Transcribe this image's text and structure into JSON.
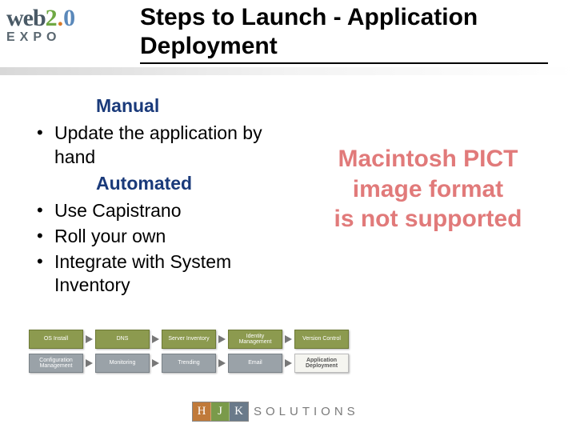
{
  "logo": {
    "web": "web",
    "two": "2",
    "dot": ".",
    "zero": "0",
    "expo": "EXPO"
  },
  "title": "Steps to Launch - Application Deployment",
  "sections": {
    "manual": {
      "label": "Manual",
      "items": [
        "Update the application by hand"
      ]
    },
    "automated": {
      "label": "Automated",
      "items": [
        "Use Capistrano",
        "Roll your own",
        "Integrate with System Inventory"
      ]
    }
  },
  "pict": {
    "line1": "Macintosh PICT",
    "line2": "image format",
    "line3": "is not supported"
  },
  "flow": {
    "row1": [
      "OS Install",
      "DNS",
      "Server Inventory",
      "Identity Management",
      "Version Control"
    ],
    "row2": [
      "Configuration Management",
      "Monitoring",
      "Trending",
      "Email",
      "Application Deployment"
    ]
  },
  "footer": {
    "h": "H",
    "j": "J",
    "k": "K",
    "solutions": "SOLUTIONS"
  }
}
